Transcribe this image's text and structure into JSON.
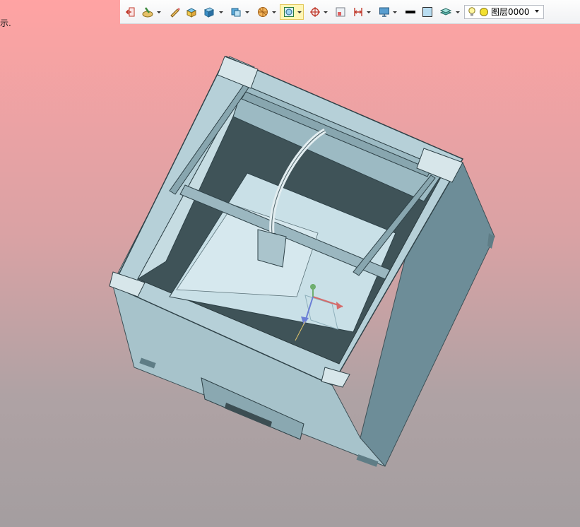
{
  "side_text": "示.",
  "layer": {
    "name": "图层0000"
  },
  "colors": {
    "bg_top": "#ffa3a3",
    "bg_bottom": "#a49ea0",
    "model_fill": "#b8d4dc",
    "model_shade": "#6b8f9a"
  },
  "toolbar": {
    "icons": [
      "exit-sketch-icon",
      "pen-palette-icon",
      "pencil-icon",
      "box-icon",
      "cube-icon",
      "view-orientation-icon",
      "render-style-icon",
      "section-view-icon",
      "snap-icon",
      "frame-icon",
      "dimension-icon",
      "monitor-icon",
      "line-color-icon",
      "fill-color-icon",
      "layer-stack-icon"
    ]
  }
}
